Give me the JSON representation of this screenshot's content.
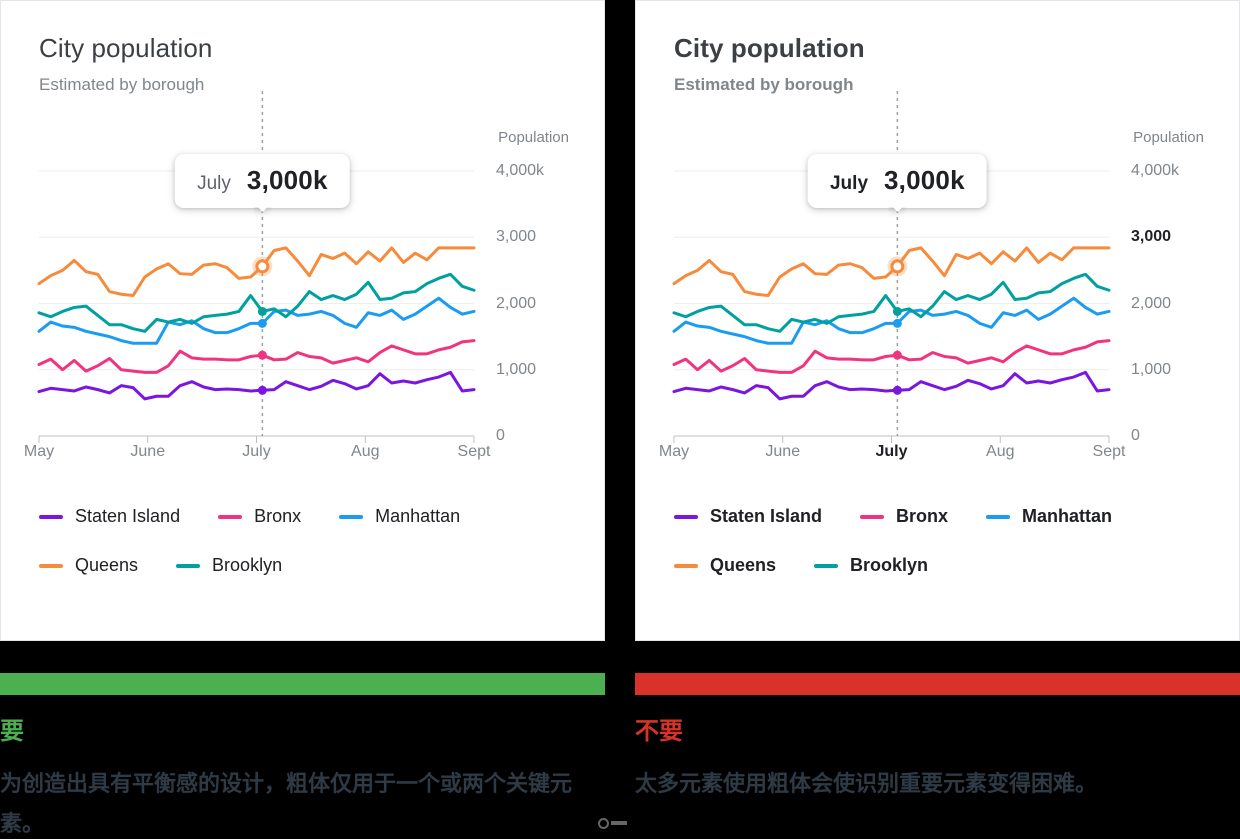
{
  "panels": [
    {
      "id": "do",
      "emphasis": false,
      "title": "City population",
      "subtitle": "Estimated by borough",
      "axis_caption": "Population",
      "tooltip": {
        "month": "July",
        "value": "3,000k"
      },
      "verdict": "要",
      "verdict_color": "#4CAF50",
      "bar_color": "#4CAF50",
      "caption": "为创造出具有平衡感的设计，粗体仅用于一个或两个关键元素。",
      "emphasized_y_tick": null,
      "emphasized_x_tick": null
    },
    {
      "id": "dont",
      "emphasis": true,
      "title": "City population",
      "subtitle": "Estimated by borough",
      "axis_caption": "Population",
      "tooltip": {
        "month": "July",
        "value": "3,000k"
      },
      "verdict": "不要",
      "verdict_color": "#D93229",
      "bar_color": "#D93229",
      "caption": "太多元素使用粗体会使识别重要元素变得困难。",
      "emphasized_y_tick": "3,000",
      "emphasized_x_tick": "July"
    }
  ],
  "chart_data": {
    "type": "line",
    "title": "City population",
    "subtitle": "Estimated by borough",
    "xlabel": "",
    "ylabel": "Population",
    "ylim": [
      0,
      4000
    ],
    "yticks": [
      0,
      1000,
      2000,
      3000,
      4000
    ],
    "ytick_labels": [
      "0",
      "1,000",
      "2,000",
      "3,000",
      "4,000k"
    ],
    "grid": true,
    "legend_position": "bottom-left",
    "categories": [
      "May",
      "June",
      "July",
      "Aug",
      "Sept"
    ],
    "xtick_labels": [
      "May",
      "June",
      "July",
      "Aug",
      "Sept"
    ],
    "highlight": {
      "x": "July",
      "series": "Queens",
      "value": 3000,
      "label": "3,000k"
    },
    "series": [
      {
        "name": "Staten Island",
        "color": "#7B16E0",
        "values": [
          670,
          720,
          700,
          680,
          740,
          700,
          650,
          760,
          730,
          560,
          600,
          600,
          760,
          820,
          740,
          700,
          710,
          700,
          680,
          690,
          700,
          820,
          760,
          700,
          750,
          840,
          790,
          710,
          760,
          940,
          800,
          830,
          800,
          850,
          890,
          960,
          680,
          700
        ]
      },
      {
        "name": "Bronx",
        "color": "#F0347F",
        "values": [
          1080,
          1160,
          1000,
          1140,
          980,
          1060,
          1170,
          1000,
          980,
          960,
          960,
          1060,
          1280,
          1180,
          1160,
          1160,
          1150,
          1150,
          1200,
          1220,
          1150,
          1160,
          1260,
          1200,
          1180,
          1100,
          1140,
          1180,
          1120,
          1260,
          1360,
          1300,
          1240,
          1240,
          1300,
          1340,
          1420,
          1440
        ]
      },
      {
        "name": "Manhattan",
        "color": "#1B9CF0",
        "values": [
          1580,
          1720,
          1660,
          1640,
          1580,
          1540,
          1500,
          1440,
          1400,
          1400,
          1400,
          1720,
          1680,
          1740,
          1620,
          1560,
          1560,
          1620,
          1700,
          1700,
          1880,
          1900,
          1820,
          1840,
          1880,
          1820,
          1700,
          1640,
          1860,
          1820,
          1900,
          1760,
          1840,
          1960,
          2080,
          1940,
          1840,
          1880
        ]
      },
      {
        "name": "Queens",
        "color": "#F68B3C",
        "values": [
          2300,
          2420,
          2500,
          2650,
          2480,
          2440,
          2180,
          2140,
          2120,
          2400,
          2520,
          2600,
          2450,
          2440,
          2580,
          2600,
          2540,
          2380,
          2400,
          2560,
          2800,
          2840,
          2640,
          2420,
          2740,
          2680,
          2760,
          2600,
          2780,
          2640,
          2840,
          2620,
          2760,
          2660,
          2840,
          2840,
          2840,
          2840
        ]
      },
      {
        "name": "Brooklyn",
        "color": "#00A0A0",
        "values": [
          1860,
          1800,
          1880,
          1940,
          1960,
          1820,
          1680,
          1680,
          1620,
          1580,
          1760,
          1720,
          1760,
          1700,
          1800,
          1820,
          1840,
          1880,
          2120,
          1880,
          1920,
          1800,
          1960,
          2180,
          2060,
          2120,
          2060,
          2140,
          2320,
          2060,
          2080,
          2160,
          2180,
          2300,
          2380,
          2440,
          2260,
          2200
        ]
      }
    ],
    "legend": [
      {
        "label": "Staten Island",
        "color": "#7B16E0"
      },
      {
        "label": "Bronx",
        "color": "#F0347F"
      },
      {
        "label": "Manhattan",
        "color": "#1B9CF0"
      },
      {
        "label": "Queens",
        "color": "#F68B3C"
      },
      {
        "label": "Brooklyn",
        "color": "#00A0A0"
      }
    ]
  }
}
